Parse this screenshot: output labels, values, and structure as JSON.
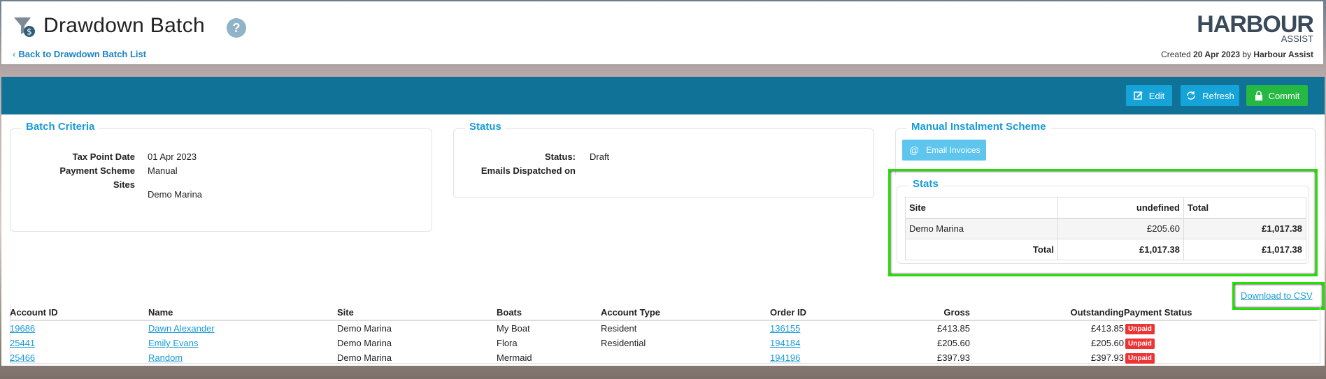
{
  "header": {
    "title": "Drawdown Batch",
    "help": "?",
    "back_link": "Back to Drawdown Batch List",
    "logo_main": "HARBOUR",
    "logo_sub": "ASSIST",
    "created_prefix": "Created",
    "created_date": "20 Apr 2023",
    "created_by_prefix": "by",
    "created_by": "Harbour Assist"
  },
  "actions": {
    "edit": "Edit",
    "refresh": "Refresh",
    "commit": "Commit"
  },
  "criteria": {
    "title": "Batch Criteria",
    "tax_point_label": "Tax Point Date",
    "tax_point_value": "01 Apr 2023",
    "payment_scheme_label": "Payment Scheme",
    "payment_scheme_value": "Manual",
    "sites_label": "Sites",
    "sites_value": "Demo Marina"
  },
  "status": {
    "title": "Status",
    "status_label": "Status:",
    "status_value": "Draft",
    "emails_label": "Emails Dispatched on"
  },
  "manual": {
    "title": "Manual Instalment Scheme",
    "email_button": "Email Invoices"
  },
  "stats": {
    "title": "Stats",
    "headers": [
      "Site",
      "undefined",
      "Total"
    ],
    "row1": [
      "Demo Marina",
      "£205.60",
      "£1,017.38"
    ],
    "total_row": [
      "Total",
      "£1,017.38",
      "£1,017.38"
    ]
  },
  "download_csv": "Download to CSV",
  "table": {
    "headers": {
      "account_id": "Account ID",
      "name": "Name",
      "site": "Site",
      "boats": "Boats",
      "account_type": "Account Type",
      "order_id": "Order ID",
      "gross": "Gross",
      "outstanding": "Outstanding",
      "payment_status": "Payment Status"
    },
    "rows": [
      {
        "account_id": "19686",
        "name": "Dawn Alexander",
        "site": "Demo Marina",
        "boats": "My Boat",
        "account_type": "Resident",
        "order_id": "136155",
        "gross": "£413.85",
        "outstanding": "£413.85",
        "status": "Unpaid"
      },
      {
        "account_id": "25441",
        "name": "Emily Evans",
        "site": "Demo Marina",
        "boats": "Flora",
        "account_type": "Residential",
        "order_id": "194184",
        "gross": "£205.60",
        "outstanding": "£205.60",
        "status": "Unpaid"
      },
      {
        "account_id": "25466",
        "name": "Random",
        "site": "Demo Marina",
        "boats": "Mermaid",
        "account_type": "",
        "order_id": "194196",
        "gross": "£397.93",
        "outstanding": "£397.93",
        "status": "Unpaid"
      }
    ]
  },
  "colors": {
    "action_bar": "#107296",
    "accent": "#1a9bd7",
    "commit": "#25b843",
    "unpaid": "#e33333",
    "highlight": "#22e000"
  }
}
